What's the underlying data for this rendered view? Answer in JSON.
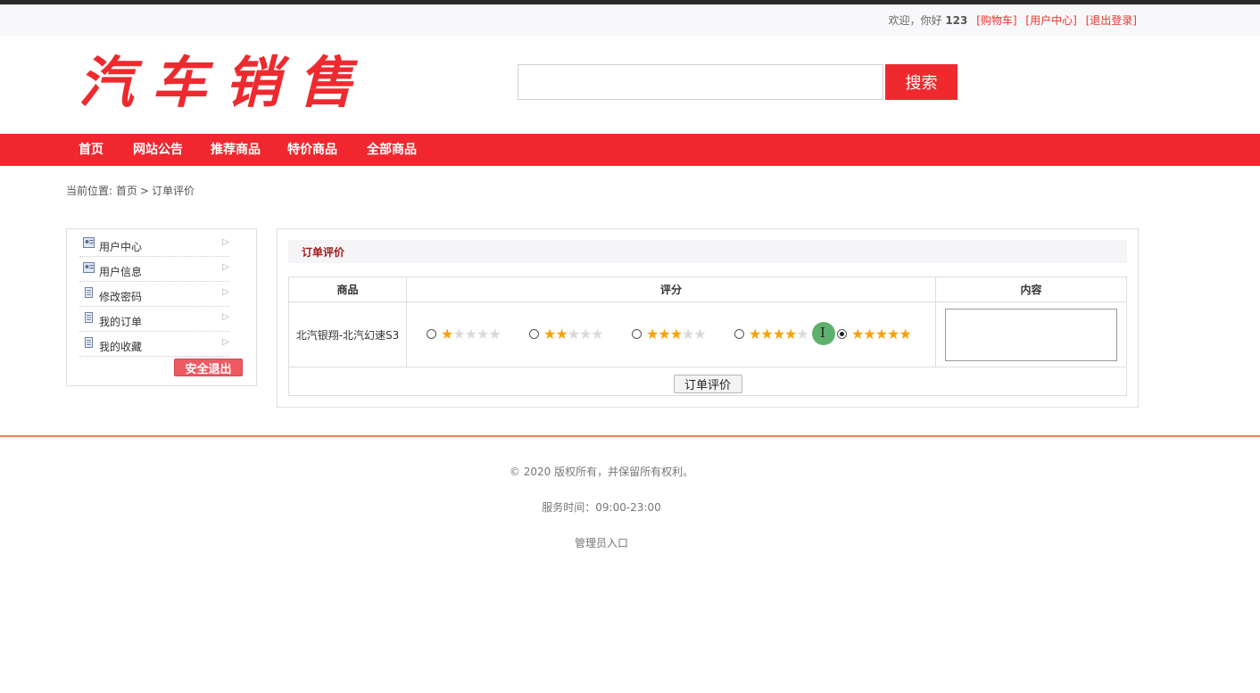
{
  "topbar": {
    "welcome": "欢迎，你好",
    "username": "123",
    "links": [
      "[购物车]",
      "[用户中心]",
      "[退出登录]"
    ]
  },
  "header": {
    "logo": "汽车销售",
    "search_placeholder": "",
    "search_button": "搜索"
  },
  "nav": {
    "items": [
      "首页",
      "网站公告",
      "推荐商品",
      "特价商品",
      "全部商品"
    ]
  },
  "breadcrumb": {
    "prefix": "当前位置:",
    "home": "首页",
    "separator": ">",
    "current": "订单评价"
  },
  "sidebar": {
    "items": [
      {
        "label": "用户中心",
        "icon": "user-card-icon"
      },
      {
        "label": "用户信息",
        "icon": "user-card-icon"
      },
      {
        "label": "修改密码",
        "icon": "document-icon"
      },
      {
        "label": "我的订单",
        "icon": "document-icon"
      },
      {
        "label": "我的收藏",
        "icon": "document-icon"
      }
    ],
    "logout_button": "安全退出"
  },
  "review": {
    "title": "订单评价",
    "columns": [
      "商品",
      "评分",
      "内容"
    ],
    "product": "北汽银翔-北汽幻速S3",
    "rating_options": [
      1,
      2,
      3,
      4,
      5
    ],
    "selected_rating": 5,
    "content_value": "",
    "submit_button": "订单评价"
  },
  "footer": {
    "copyright": "© 2020 版权所有，并保留所有权利。",
    "service_hours": "服务时间：09:00-23:00",
    "admin_link": "管理员入口"
  },
  "colors": {
    "brand_red": "#ee2a2f",
    "star": "#f7a10d",
    "panel_title": "#a01b18"
  }
}
